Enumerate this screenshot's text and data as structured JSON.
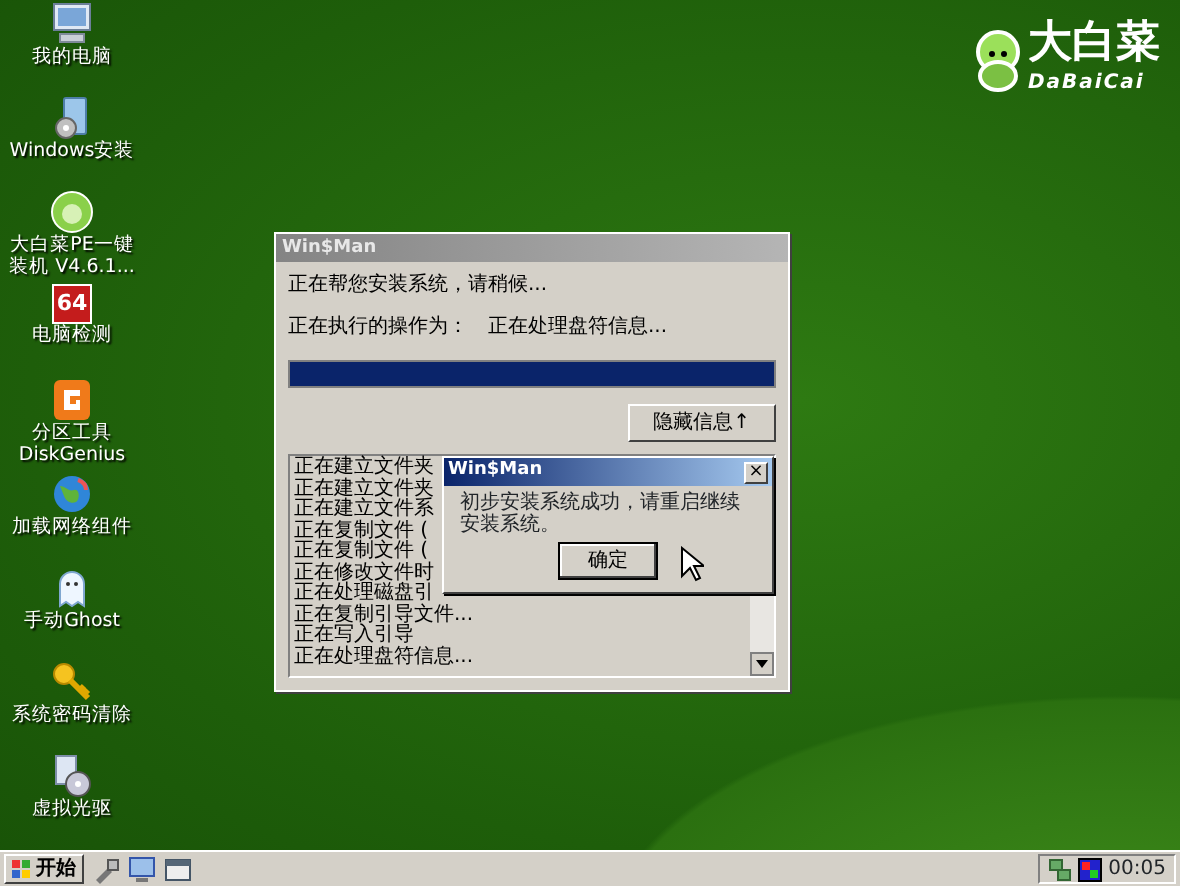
{
  "desktop_icons": [
    {
      "kind": "computer",
      "label": "我的电脑"
    },
    {
      "kind": "setup",
      "label": "Windows安装"
    },
    {
      "kind": "cabbage",
      "label": "大白菜PE一键装机 V4.6.1..."
    },
    {
      "kind": "detect",
      "label": "电脑检测",
      "badge": "64"
    },
    {
      "kind": "partition",
      "label": "分区工具 DiskGenius"
    },
    {
      "kind": "network",
      "label": "加载网络组件"
    },
    {
      "kind": "ghost",
      "label": "手动Ghost"
    },
    {
      "kind": "key",
      "label": "系统密码清除"
    },
    {
      "kind": "disc",
      "label": "虚拟光驱"
    }
  ],
  "logo": {
    "title": "大白菜",
    "subtitle": "DaBaiCai"
  },
  "main_window": {
    "title": "Win$Man",
    "status": "正在帮您安装系统，请稍候...",
    "operation_label": "正在执行的操作为：",
    "operation": "正在处理盘符信息...",
    "progress": {
      "level": 1
    },
    "hide_button": "隐藏信息↑",
    "log": [
      "正在建立文件夹",
      "正在建立文件夹",
      "正在建立文件系",
      "正在复制文件 (",
      "正在复制文件 (",
      "正在修改文件时",
      "正在处理磁盘引",
      "正在复制引导文件...",
      "正在写入引导",
      "正在处理盘符信息..."
    ]
  },
  "dialog": {
    "title": "Win$Man",
    "close": "×",
    "message": "初步安装系统成功，请重启继续安装系统。",
    "ok_button": "确定"
  },
  "taskbar": {
    "start": "开始",
    "quick_launch": [
      {
        "kind": "tools"
      },
      {
        "kind": "monitor"
      },
      {
        "kind": "window"
      }
    ],
    "tray": [
      {
        "kind": "network"
      },
      {
        "kind": "color"
      }
    ],
    "clock": "00:05"
  }
}
